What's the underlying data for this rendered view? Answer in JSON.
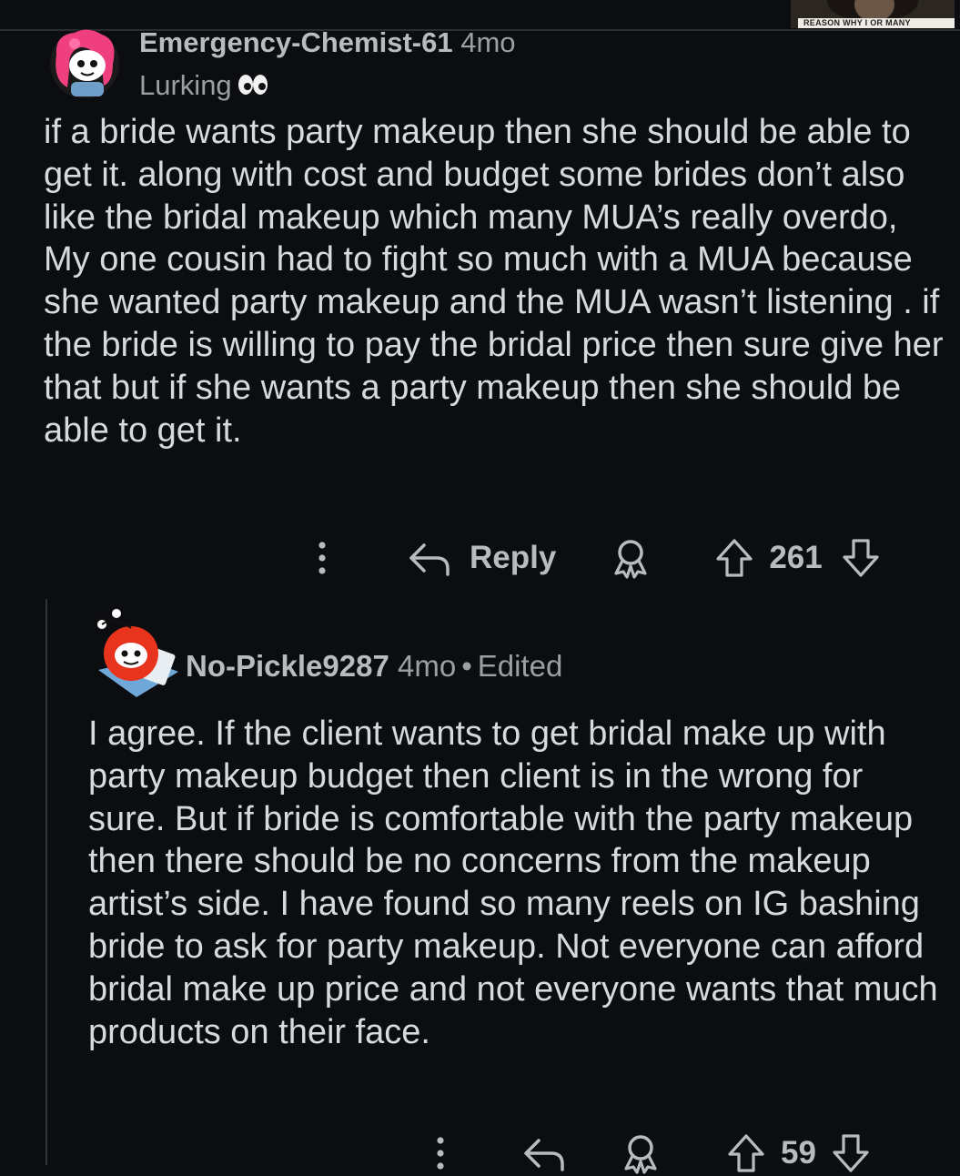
{
  "overlay": {
    "pip_caption": "REASON WHY I OR MANY"
  },
  "comment": {
    "username": "Emergency-Chemist-61",
    "age": "4mo",
    "flair_text": "Lurking",
    "flair_emoji": "eyes-emoji",
    "body": "if a bride wants party makeup then she should be able to get it. along with cost and budget some brides don’t also like the bridal makeup which many MUA’s really overdo, My one cousin had to fight so much with a MUA because she wanted party makeup and the MUA wasn’t listening . if the bride is willing to pay the bridal price then sure give her that but if she wants a party makeup then she should be able to get it.",
    "actions": {
      "reply_label": "Reply",
      "score": "261"
    }
  },
  "reply": {
    "username": "No-Pickle9287",
    "age": "4mo",
    "separator": "•",
    "edited_label": "Edited",
    "body": "I agree. If the client wants to get bridal make up with party makeup budget then client is in the wrong for sure. But if bride is comfortable with the party makeup then there should be no concerns from the makeup artist’s side. I have found so many reels on IG bashing bride to ask for party makeup. Not everyone can afford bridal make up price and not everyone wants that much products on their face.",
    "actions": {
      "score": "59"
    }
  },
  "colors": {
    "background": "#0b0d10",
    "text": "#d7dadc",
    "muted": "#9aa0a4",
    "action": "#b7bcbf",
    "thread_line": "#30343a"
  },
  "icons": [
    "more-icon",
    "reply-icon",
    "award-icon",
    "upvote-icon",
    "downvote-icon"
  ]
}
